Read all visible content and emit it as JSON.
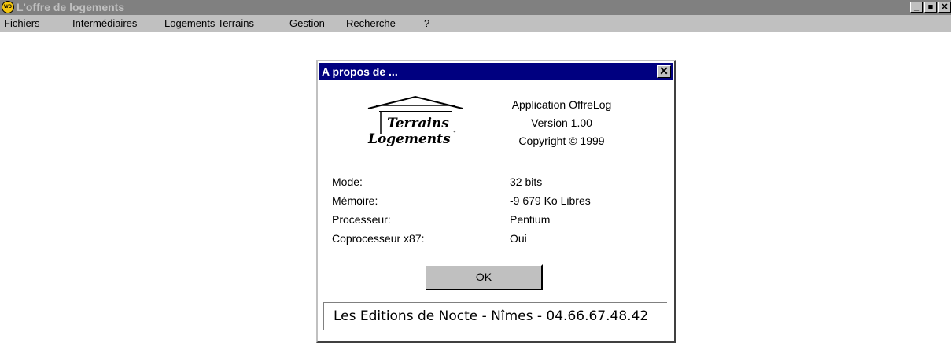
{
  "window": {
    "title": "L'offre de logements",
    "app_icon": "windev-icon",
    "icon_text": "WD",
    "buttons": {
      "minimize": "_",
      "maximize": "■",
      "close": "✕"
    }
  },
  "menu": [
    "Fichiers",
    "Intermédiaires",
    "Logements Terrains",
    "Gestion",
    "Recherche",
    "?"
  ],
  "dialog": {
    "title": "A propos de ...",
    "close_label": "✕",
    "logo_text": {
      "line1": "Terrains",
      "line2": "Logements",
      "mark": "¸"
    },
    "app_info": [
      "Application OffreLog",
      "Version 1.00",
      "Copyright © 1999"
    ],
    "info_rows": [
      {
        "label": "Mode:",
        "value": "32 bits"
      },
      {
        "label": "Mémoire:",
        "value": "-9 679 Ko Libres"
      },
      {
        "label": "Processeur:",
        "value": "Pentium"
      },
      {
        "label": "Coprocesseur x87:",
        "value": "Oui"
      }
    ],
    "ok_label": "OK",
    "footer": "Les Editions de Nocte - Nîmes - 04.66.67.48.42"
  },
  "colors": {
    "titlebar_inactive": "#808080",
    "dialog_titlebar": "#000080",
    "face": "#c0c0c0"
  }
}
